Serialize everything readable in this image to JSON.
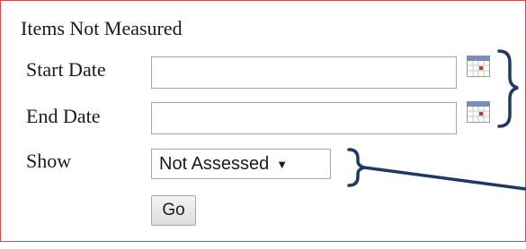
{
  "panel": {
    "heading": "Items Not Measured",
    "start_date": {
      "label": "Start Date",
      "value": "",
      "calendar_icon": "calendar-icon"
    },
    "end_date": {
      "label": "End Date",
      "value": "",
      "calendar_icon": "calendar-icon"
    },
    "show": {
      "label": "Show",
      "selected": "Not Assessed",
      "arrow": "▼"
    },
    "go_label": "Go"
  },
  "colors": {
    "panel_border": "#c0504d",
    "annotation_stroke": "#1f3864"
  }
}
